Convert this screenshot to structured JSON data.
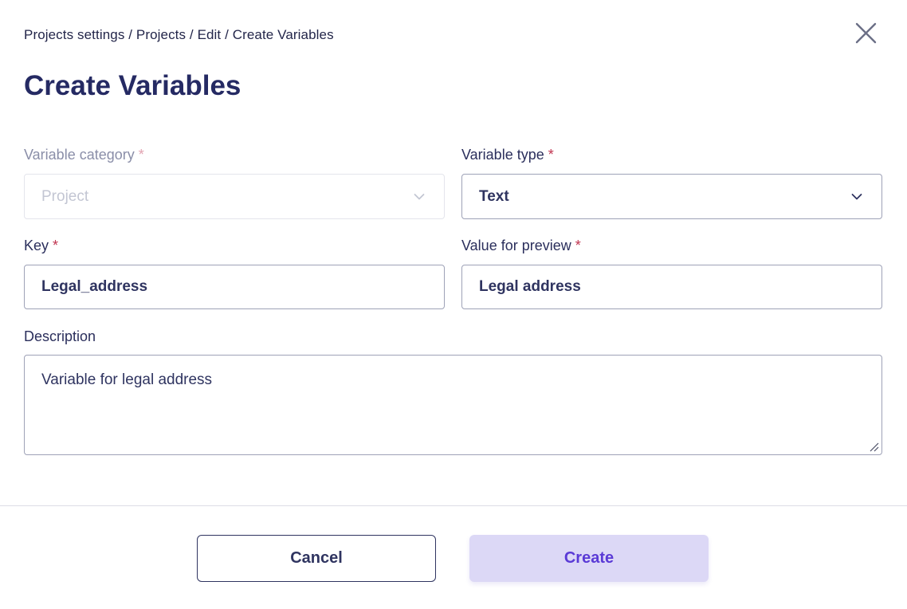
{
  "header": {
    "breadcrumb": "Projects settings / Projects / Edit / Create Variables",
    "title": "Create Variables",
    "close_icon": "close-icon"
  },
  "form": {
    "variable_category": {
      "label": "Variable category",
      "required_mark": "*",
      "value": "Project",
      "disabled": true
    },
    "variable_type": {
      "label": "Variable type",
      "required_mark": "*",
      "value": "Text"
    },
    "key": {
      "label": "Key",
      "required_mark": "*",
      "value": "Legal_address"
    },
    "value_for_preview": {
      "label": "Value for preview",
      "required_mark": "*",
      "value": "Legal address"
    },
    "description": {
      "label": "Description",
      "value": "Variable for legal address"
    }
  },
  "footer": {
    "cancel_label": "Cancel",
    "create_label": "Create"
  },
  "colors": {
    "title": "#252a63",
    "required": "#c0344f",
    "create_button_bg": "#dcd8f6",
    "create_button_text": "#5a3ad6",
    "border": "#9ea2b7"
  }
}
